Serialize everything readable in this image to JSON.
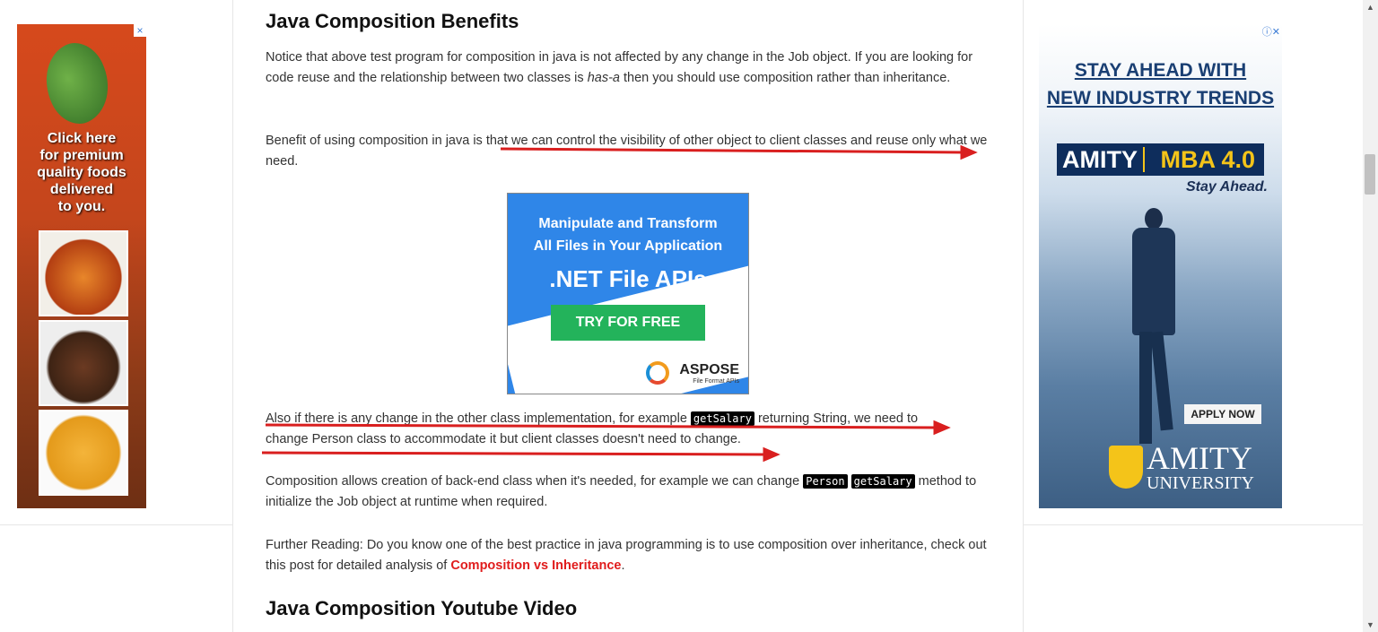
{
  "left_ad": {
    "close_icon": "×",
    "text_lines": [
      "Click here",
      "for premium",
      "quality foods",
      "delivered",
      "to you."
    ]
  },
  "article": {
    "heading1": "Java Composition Benefits",
    "p1_a": "Notice that above test program for composition in java is not affected by any change in the Job object. If you are looking for code reuse and the relationship between two classes is ",
    "p1_em": "has-a",
    "p1_b": " then you should use composition rather than inheritance.",
    "p2": "Benefit of using composition in java is that we can control the visibility of other object to client classes and reuse only what we need.",
    "p3_a": "Also if there is any change in the other class implementation, for example ",
    "p3_code": "getSalary",
    "p3_b": " returning String, we need to change Person class to accommodate it but client classes doesn't need to change.",
    "p4_a": "Composition allows creation of back-end class when it's needed, for example we can change ",
    "p4_code1": "Person",
    "p4_code2": "getSalary",
    "p4_b": " method to initialize the Job object at runtime when required.",
    "p5_a": "Further Reading: Do you know one of the best practice in java programming is to use composition over inheritance, check out this post for detailed analysis of ",
    "p5_link": "Composition vs Inheritance",
    "p5_b": ".",
    "heading2": "Java Composition Youtube Video"
  },
  "center_ad": {
    "line1": "Manipulate and Transform",
    "line2": "All Files in Your Application",
    "line3": ".NET File APIs",
    "button": "TRY FOR FREE",
    "brand": "ASPOSE",
    "brand_sub": "File Format APIs"
  },
  "right_ad": {
    "adchoices": "ⓘ✕",
    "headline1": "STAY AHEAD WITH",
    "headline2": "NEW INDUSTRY TRENDS",
    "logo_left": "AMITY",
    "logo_right": "MBA 4.0",
    "tagline": "Stay Ahead.",
    "apply": "APPLY NOW",
    "uni1": "AMITY",
    "uni2": "UNIVERSITY"
  },
  "colors": {
    "annotation_arrow": "#d91f1f",
    "link": "#e01c1c"
  }
}
